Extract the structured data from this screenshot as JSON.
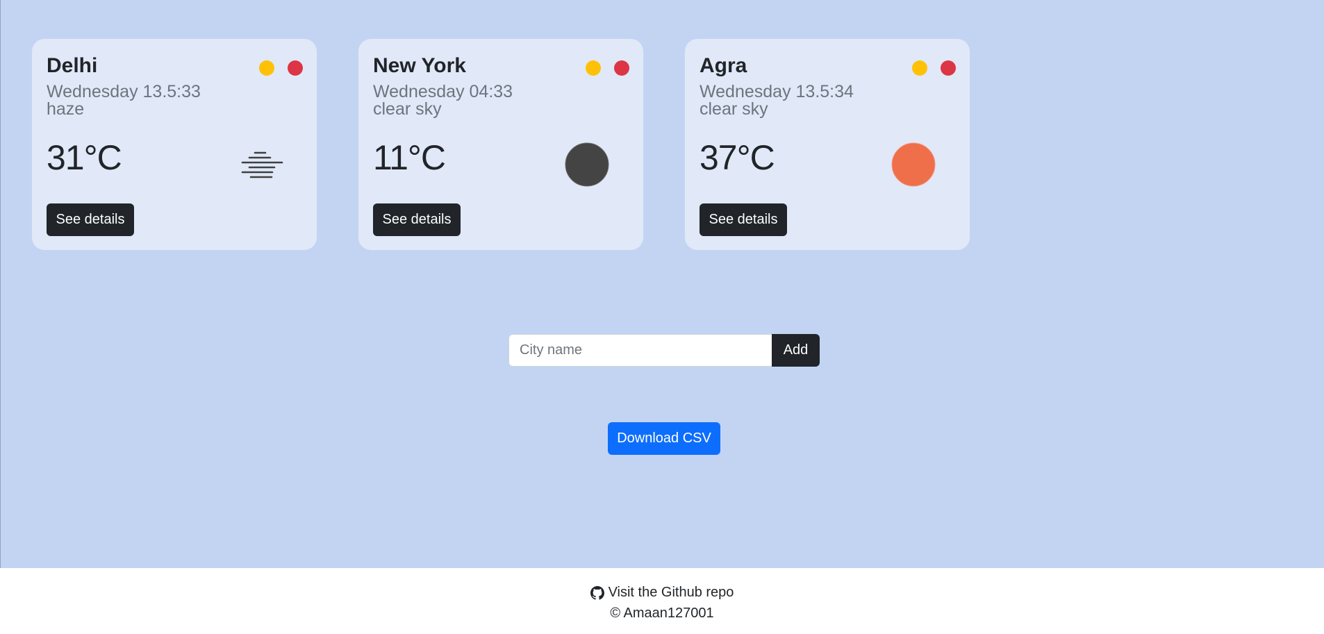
{
  "cards": [
    {
      "city": "Delhi",
      "datetime": "Wednesday 13.5:33",
      "description": "haze",
      "temperature": "31°C",
      "icon": "haze-icon",
      "details_label": "See details"
    },
    {
      "city": "New York",
      "datetime": "Wednesday 04:33",
      "description": "clear sky",
      "temperature": "11°C",
      "icon": "clear-night-icon",
      "details_label": "See details"
    },
    {
      "city": "Agra",
      "datetime": "Wednesday 13.5:34",
      "description": "clear sky",
      "temperature": "37°C",
      "icon": "clear-day-sun-icon",
      "details_label": "See details"
    }
  ],
  "city_form": {
    "placeholder": "City name",
    "value": "",
    "add_label": "Add"
  },
  "csv_button_label": "Download CSV",
  "footer": {
    "repo_link_label": "Visit the Github repo",
    "copyright": "© Amaan127001",
    "icon": "github-icon"
  },
  "colors": {
    "background": "#c3d4f3",
    "card": "#e1e8f8",
    "dark_button": "#212529",
    "primary_button": "#0d6efd",
    "dot_yellow": "#ffc107",
    "dot_red": "#dc3545",
    "night_icon": "#444444",
    "sun_icon": "#ef6f4b"
  }
}
